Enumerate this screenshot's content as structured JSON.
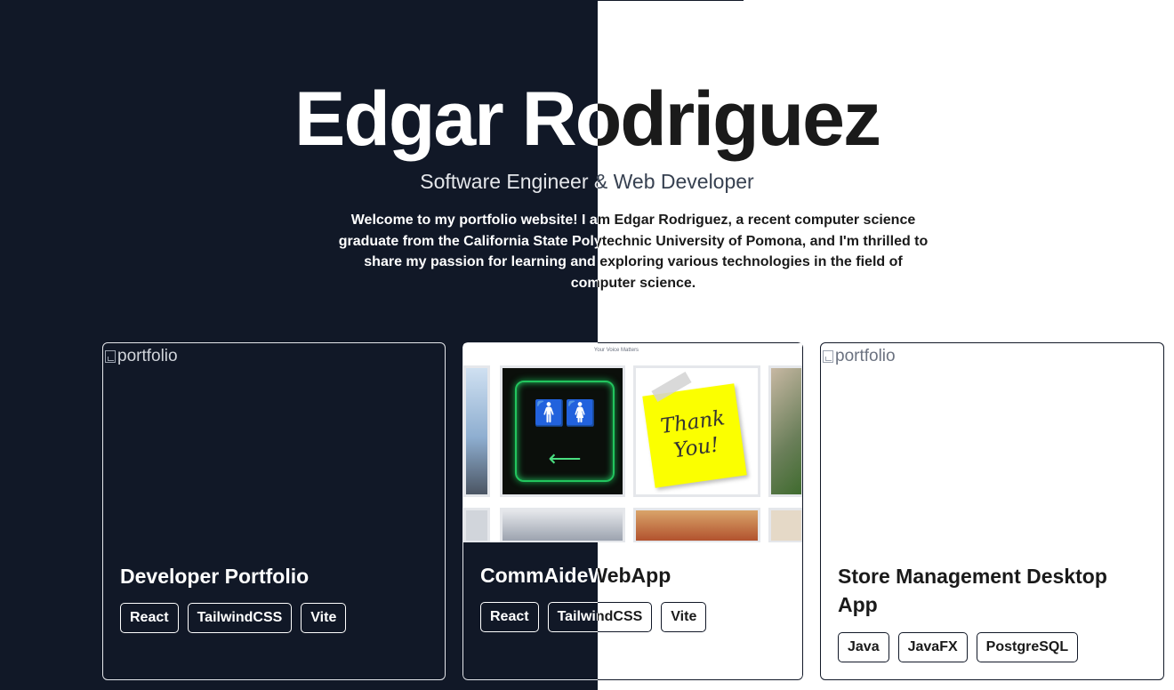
{
  "hero": {
    "name": "Edgar Rodriguez",
    "subtitle": "Software Engineer & Web Developer",
    "description": "Welcome to my portfolio website! I am Edgar Rodriguez, a recent computer science graduate from the California State Polytechnic University of Pomona, and I'm thrilled to share my passion for learning and exploring various technologies in the field of computer science."
  },
  "projects": [
    {
      "image_alt": "portfolio",
      "title": "Developer Portfolio",
      "tags": [
        "React",
        "TailwindCSS",
        "Vite"
      ]
    },
    {
      "preview_caption": "Your Voice Matters",
      "sticky_note": "Thank You!",
      "title": "CommAideWebApp",
      "tags": [
        "React",
        "TailwindCSS",
        "Vite"
      ]
    },
    {
      "image_alt": "portfolio",
      "title": "Store Management Desktop App",
      "tags": [
        "Java",
        "JavaFX",
        "PostgreSQL"
      ]
    }
  ],
  "colors": {
    "dark_bg": "#111827",
    "light_bg": "#ffffff"
  }
}
